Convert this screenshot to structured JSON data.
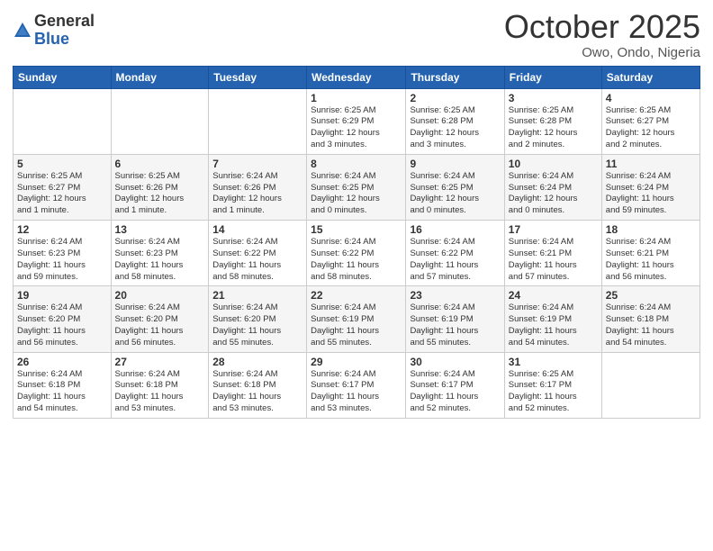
{
  "header": {
    "logo_general": "General",
    "logo_blue": "Blue",
    "month": "October 2025",
    "location": "Owo, Ondo, Nigeria"
  },
  "weekdays": [
    "Sunday",
    "Monday",
    "Tuesday",
    "Wednesday",
    "Thursday",
    "Friday",
    "Saturday"
  ],
  "weeks": [
    [
      {
        "day": "",
        "info": ""
      },
      {
        "day": "",
        "info": ""
      },
      {
        "day": "",
        "info": ""
      },
      {
        "day": "1",
        "info": "Sunrise: 6:25 AM\nSunset: 6:29 PM\nDaylight: 12 hours\nand 3 minutes."
      },
      {
        "day": "2",
        "info": "Sunrise: 6:25 AM\nSunset: 6:28 PM\nDaylight: 12 hours\nand 3 minutes."
      },
      {
        "day": "3",
        "info": "Sunrise: 6:25 AM\nSunset: 6:28 PM\nDaylight: 12 hours\nand 2 minutes."
      },
      {
        "day": "4",
        "info": "Sunrise: 6:25 AM\nSunset: 6:27 PM\nDaylight: 12 hours\nand 2 minutes."
      }
    ],
    [
      {
        "day": "5",
        "info": "Sunrise: 6:25 AM\nSunset: 6:27 PM\nDaylight: 12 hours\nand 1 minute."
      },
      {
        "day": "6",
        "info": "Sunrise: 6:25 AM\nSunset: 6:26 PM\nDaylight: 12 hours\nand 1 minute."
      },
      {
        "day": "7",
        "info": "Sunrise: 6:24 AM\nSunset: 6:26 PM\nDaylight: 12 hours\nand 1 minute."
      },
      {
        "day": "8",
        "info": "Sunrise: 6:24 AM\nSunset: 6:25 PM\nDaylight: 12 hours\nand 0 minutes."
      },
      {
        "day": "9",
        "info": "Sunrise: 6:24 AM\nSunset: 6:25 PM\nDaylight: 12 hours\nand 0 minutes."
      },
      {
        "day": "10",
        "info": "Sunrise: 6:24 AM\nSunset: 6:24 PM\nDaylight: 12 hours\nand 0 minutes."
      },
      {
        "day": "11",
        "info": "Sunrise: 6:24 AM\nSunset: 6:24 PM\nDaylight: 11 hours\nand 59 minutes."
      }
    ],
    [
      {
        "day": "12",
        "info": "Sunrise: 6:24 AM\nSunset: 6:23 PM\nDaylight: 11 hours\nand 59 minutes."
      },
      {
        "day": "13",
        "info": "Sunrise: 6:24 AM\nSunset: 6:23 PM\nDaylight: 11 hours\nand 58 minutes."
      },
      {
        "day": "14",
        "info": "Sunrise: 6:24 AM\nSunset: 6:22 PM\nDaylight: 11 hours\nand 58 minutes."
      },
      {
        "day": "15",
        "info": "Sunrise: 6:24 AM\nSunset: 6:22 PM\nDaylight: 11 hours\nand 58 minutes."
      },
      {
        "day": "16",
        "info": "Sunrise: 6:24 AM\nSunset: 6:22 PM\nDaylight: 11 hours\nand 57 minutes."
      },
      {
        "day": "17",
        "info": "Sunrise: 6:24 AM\nSunset: 6:21 PM\nDaylight: 11 hours\nand 57 minutes."
      },
      {
        "day": "18",
        "info": "Sunrise: 6:24 AM\nSunset: 6:21 PM\nDaylight: 11 hours\nand 56 minutes."
      }
    ],
    [
      {
        "day": "19",
        "info": "Sunrise: 6:24 AM\nSunset: 6:20 PM\nDaylight: 11 hours\nand 56 minutes."
      },
      {
        "day": "20",
        "info": "Sunrise: 6:24 AM\nSunset: 6:20 PM\nDaylight: 11 hours\nand 56 minutes."
      },
      {
        "day": "21",
        "info": "Sunrise: 6:24 AM\nSunset: 6:20 PM\nDaylight: 11 hours\nand 55 minutes."
      },
      {
        "day": "22",
        "info": "Sunrise: 6:24 AM\nSunset: 6:19 PM\nDaylight: 11 hours\nand 55 minutes."
      },
      {
        "day": "23",
        "info": "Sunrise: 6:24 AM\nSunset: 6:19 PM\nDaylight: 11 hours\nand 55 minutes."
      },
      {
        "day": "24",
        "info": "Sunrise: 6:24 AM\nSunset: 6:19 PM\nDaylight: 11 hours\nand 54 minutes."
      },
      {
        "day": "25",
        "info": "Sunrise: 6:24 AM\nSunset: 6:18 PM\nDaylight: 11 hours\nand 54 minutes."
      }
    ],
    [
      {
        "day": "26",
        "info": "Sunrise: 6:24 AM\nSunset: 6:18 PM\nDaylight: 11 hours\nand 54 minutes."
      },
      {
        "day": "27",
        "info": "Sunrise: 6:24 AM\nSunset: 6:18 PM\nDaylight: 11 hours\nand 53 minutes."
      },
      {
        "day": "28",
        "info": "Sunrise: 6:24 AM\nSunset: 6:18 PM\nDaylight: 11 hours\nand 53 minutes."
      },
      {
        "day": "29",
        "info": "Sunrise: 6:24 AM\nSunset: 6:17 PM\nDaylight: 11 hours\nand 53 minutes."
      },
      {
        "day": "30",
        "info": "Sunrise: 6:24 AM\nSunset: 6:17 PM\nDaylight: 11 hours\nand 52 minutes."
      },
      {
        "day": "31",
        "info": "Sunrise: 6:25 AM\nSunset: 6:17 PM\nDaylight: 11 hours\nand 52 minutes."
      },
      {
        "day": "",
        "info": ""
      }
    ]
  ]
}
